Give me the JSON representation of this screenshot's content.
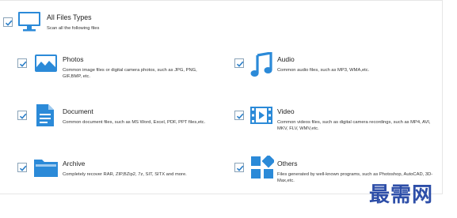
{
  "header": {
    "title": "All Files Types",
    "subtitle": "Scan all the following files",
    "checked": true,
    "icon": "monitor-icon"
  },
  "items": [
    {
      "key": "photos",
      "title": "Photos",
      "desc": "Common image files or digital camera photos, such as JPG, PNG, GIF,BMP, etc.",
      "checked": true,
      "icon": "image-icon"
    },
    {
      "key": "audio",
      "title": "Audio",
      "desc": "Common audio files, such as MP3, WMA,etc.",
      "checked": true,
      "icon": "music-note-icon"
    },
    {
      "key": "document",
      "title": "Document",
      "desc": "Common document files, such as MS Word, Excel, PDF, PPT files,etc.",
      "checked": true,
      "icon": "document-icon"
    },
    {
      "key": "video",
      "title": "Video",
      "desc": "Common videos files, such as digital camera recordings, such as MP4, AVI, MKV, FLV, WMV,etc.",
      "checked": true,
      "icon": "film-icon"
    },
    {
      "key": "archive",
      "title": "Archive",
      "desc": "Completely recover RAR, ZIP,BZip2, 7z, SIT, SITX and more.",
      "checked": true,
      "icon": "folder-icon"
    },
    {
      "key": "others",
      "title": "Others",
      "desc": "Files generated by well-known programs, such as Photoshop, AutoCAD, 3D-Max,etc.",
      "checked": true,
      "icon": "grid-icon"
    }
  ],
  "watermark": "最需网",
  "colors": {
    "accent": "#2b8ad8",
    "check": "#2b7fc9",
    "watermark": "#2d4ea8"
  }
}
